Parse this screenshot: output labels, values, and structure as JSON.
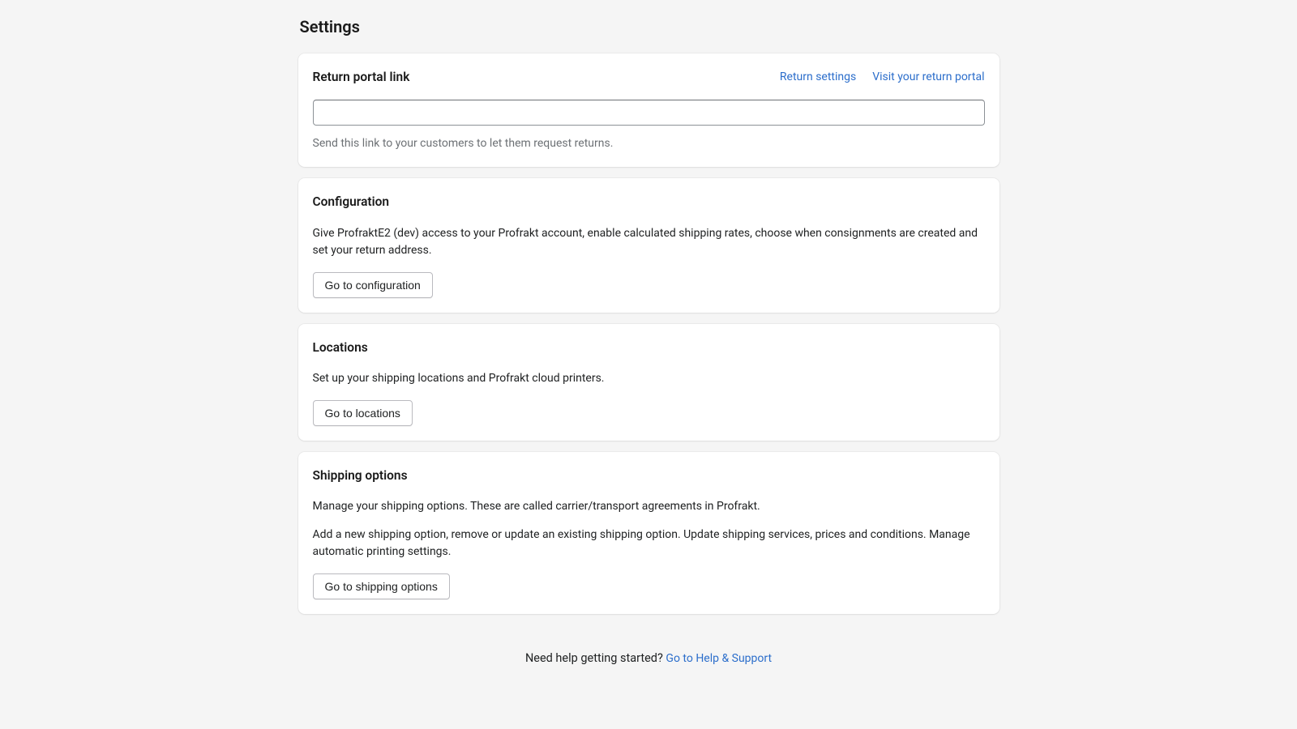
{
  "page": {
    "title": "Settings"
  },
  "return_portal": {
    "title": "Return portal link",
    "return_settings_link": "Return settings",
    "visit_portal_link": "Visit your return portal",
    "input_value": "",
    "help_text": "Send this link to your customers to let them request returns."
  },
  "configuration": {
    "title": "Configuration",
    "description": "Give ProfraktE2 (dev) access to your Profrakt account, enable calculated shipping rates, choose when consignments are created and set your return address.",
    "button_label": "Go to configuration"
  },
  "locations": {
    "title": "Locations",
    "description": "Set up your shipping locations and Profrakt cloud printers.",
    "button_label": "Go to locations"
  },
  "shipping_options": {
    "title": "Shipping options",
    "description1": "Manage your shipping options. These are called carrier/transport agreements in Profrakt.",
    "description2": "Add a new shipping option, remove or update an existing shipping option. Update shipping services, prices and conditions. Manage automatic printing settings.",
    "button_label": "Go to shipping options"
  },
  "footer": {
    "help_text": "Need help getting started? ",
    "help_link": "Go to Help & Support"
  }
}
